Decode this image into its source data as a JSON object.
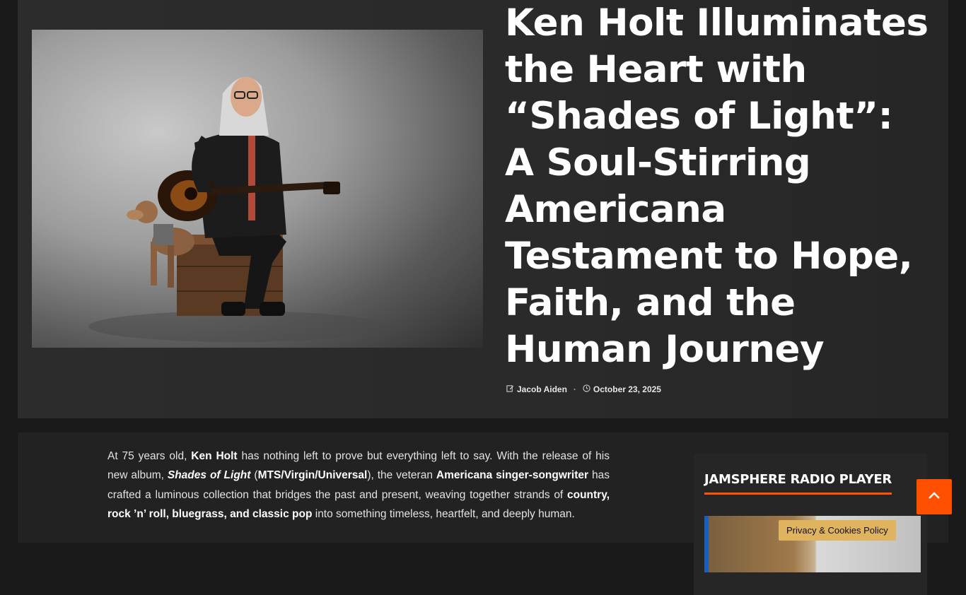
{
  "article": {
    "title": "Ken Holt Illuminates the Heart with “Shades of Light”: A Soul-Stirring Americana Testament to Hope, Faith, and the Human Journey",
    "author": "Jacob Aiden",
    "date": "October 23, 2025",
    "separator": "·",
    "intro": {
      "t1": "At 75 years old, ",
      "b1": "Ken Holt",
      "t2": " has nothing left to prove but everything left to say. With the release of his new album, ",
      "b2": "Shades of Light",
      "t3": " (",
      "b3": "MTS/Virgin/Universal",
      "t4": "), the veteran ",
      "b4": "Americana singer-songwriter",
      "t5": " has crafted a luminous collection that bridges the past and present, weaving together strands of ",
      "b5": "country, rock ’n’ roll, bluegrass, and classic pop",
      "t6": " into something timeless, heartfelt, and deeply human."
    }
  },
  "sidebar": {
    "widget_title": "JAMSPHERE RADIO PLAYER"
  },
  "cookie": {
    "label": "Privacy & Cookies Policy"
  },
  "icons": {
    "author": "edit-icon",
    "date": "clock-icon",
    "scroll_top": "chevron-up-icon"
  },
  "colors": {
    "accent": "#ff5500",
    "cookie_bg": "#e0b35f"
  }
}
